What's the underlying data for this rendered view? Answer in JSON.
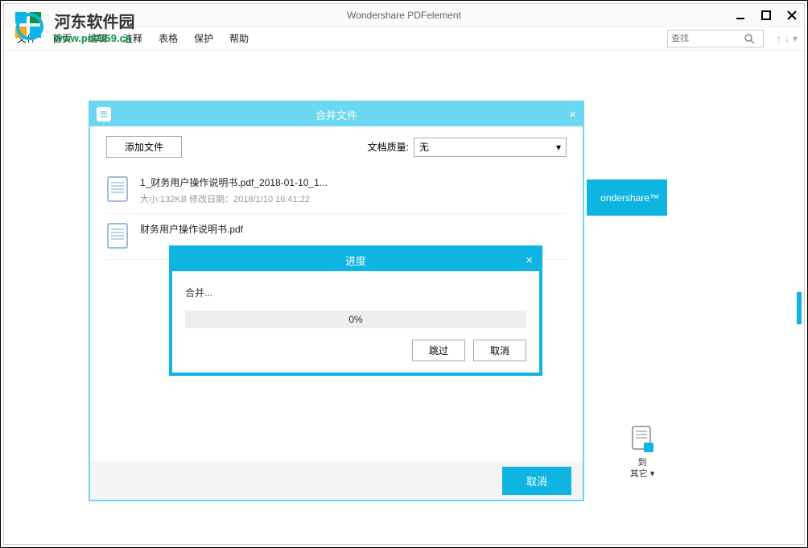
{
  "window": {
    "title": "Wondershare PDFelement"
  },
  "menu": {
    "items": [
      "文件",
      "首页",
      "编辑",
      "注释",
      "表格",
      "保护",
      "帮助"
    ]
  },
  "search": {
    "placeholder": "查找"
  },
  "watermark": {
    "title": "河东软件园",
    "url": "www.pc0359.cn"
  },
  "bg_panel": {
    "brand": "ondershare™"
  },
  "merge_dialog": {
    "title": "合并文件",
    "add_button": "添加文件",
    "quality_label": "文档质量:",
    "quality_value": "无",
    "files": [
      {
        "name": "1_财务用户操作说明书.pdf_2018-01-10_1...",
        "meta": "大小:132KB 修改日期：2018/1/10 16:41:22"
      },
      {
        "name": "财务用户操作说明书.pdf",
        "meta": ""
      }
    ],
    "cancel": "取消"
  },
  "progress_dialog": {
    "title": "进度",
    "label": "合并...",
    "percent": "0%",
    "skip": "跳过",
    "cancel": "取消"
  },
  "side_tool": {
    "line1": "到",
    "line2": "其它"
  }
}
